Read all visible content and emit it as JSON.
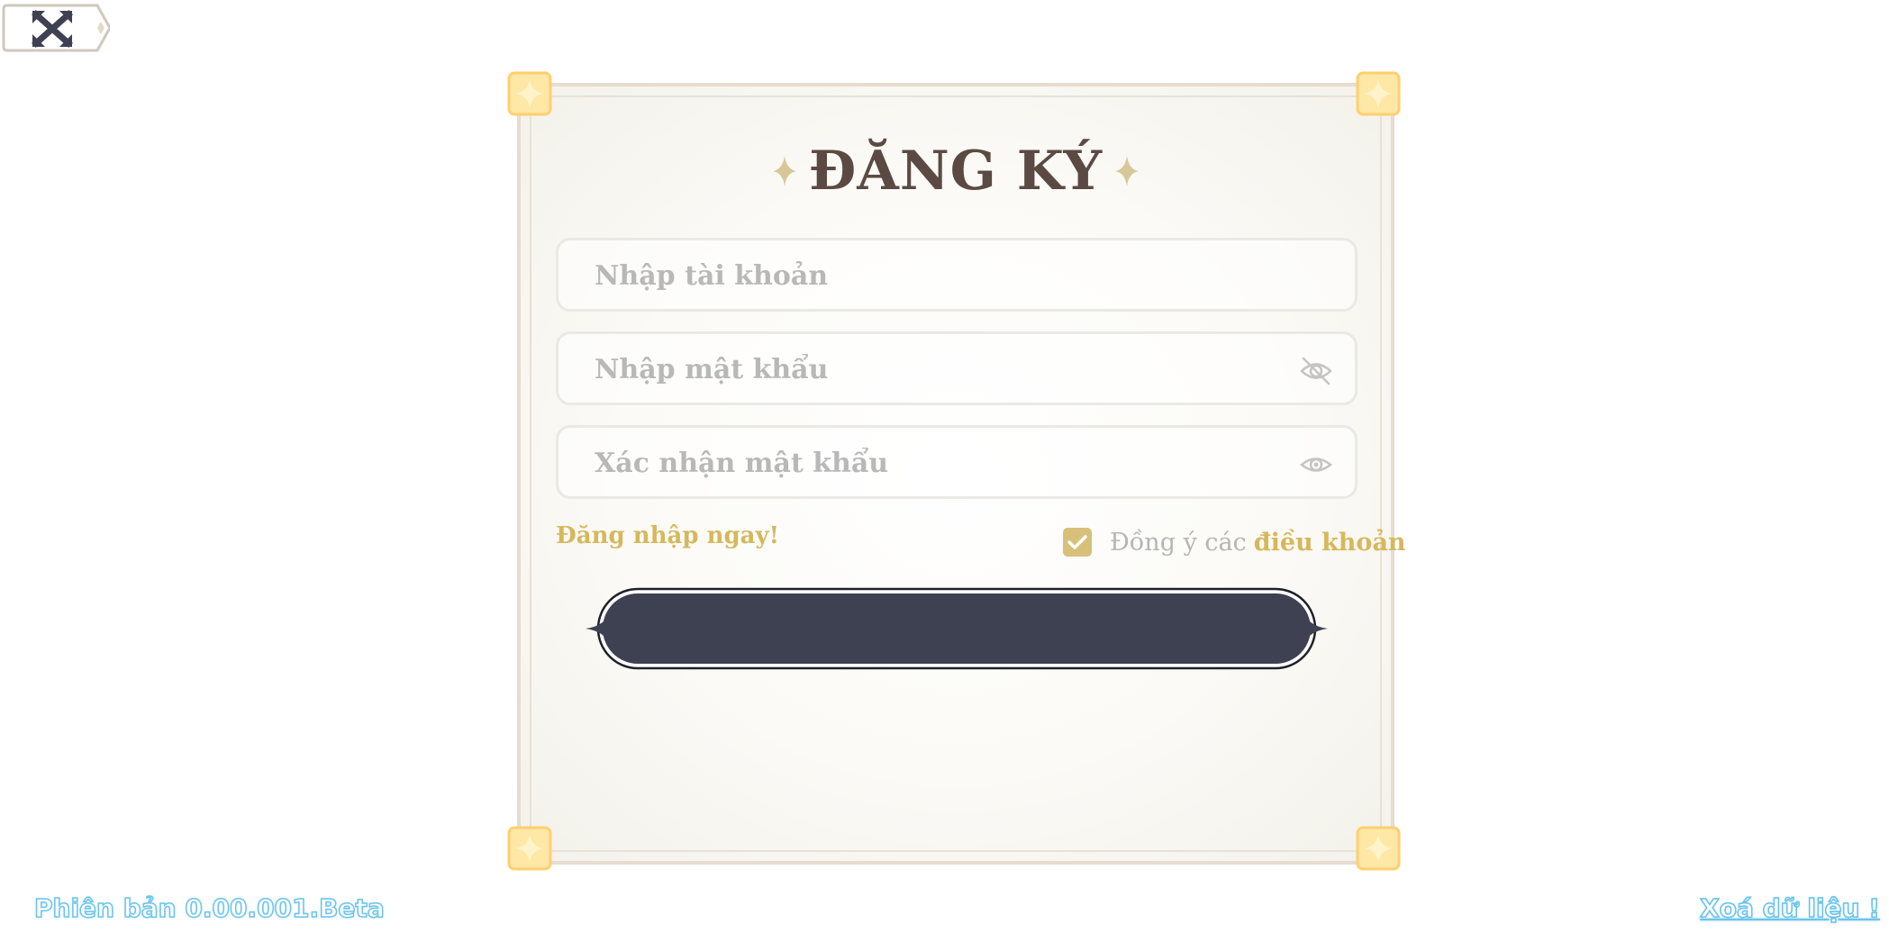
{
  "header": {
    "back_icon": "close-arrows-icon"
  },
  "form": {
    "title": "ĐĂNG KÝ",
    "username_placeholder": "Nhập tài khoản",
    "password_placeholder": "Nhập mật khẩu",
    "confirm_placeholder": "Xác nhận mật khẩu",
    "password_eye_icon": "eye-off-icon",
    "confirm_eye_icon": "eye-icon",
    "login_link": "Đăng nhập ngay!",
    "agree_text": "Đồng ý các",
    "terms_link": "điều khoản",
    "terms_checked": true,
    "submit_label": ""
  },
  "footer": {
    "version": "Phiên bản 0.00.001.Beta",
    "clear_data": "Xoá dữ liệu !"
  },
  "colors": {
    "title": "#5b4a43",
    "accent_gold": "#d6b85c",
    "button_dark": "#3e4152",
    "footer_blue": "#6cc4ec"
  }
}
